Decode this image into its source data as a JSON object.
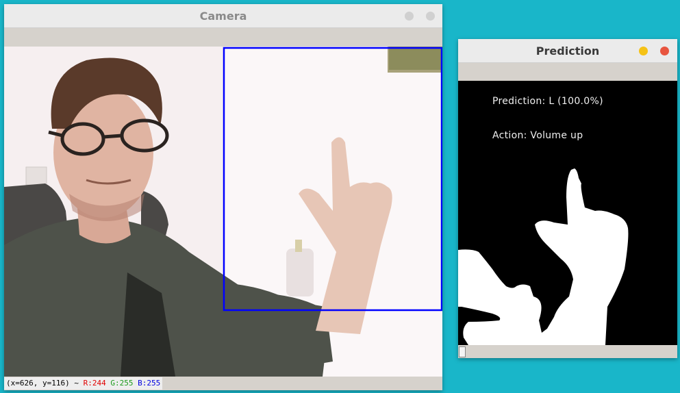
{
  "camera_window": {
    "title": "Camera",
    "status": {
      "coords": "(x=626, y=116) ~",
      "r": "R:244",
      "g": "G:255",
      "b": "B:255"
    },
    "roi_color": "#0000ff"
  },
  "prediction_window": {
    "title": "Prediction",
    "prediction_text": "Prediction: L (100.0%)",
    "action_text": "Action: Volume up",
    "minimize_color": "#f5c216",
    "close_color": "#e8553f"
  },
  "desktop_color": "#19b6c9"
}
